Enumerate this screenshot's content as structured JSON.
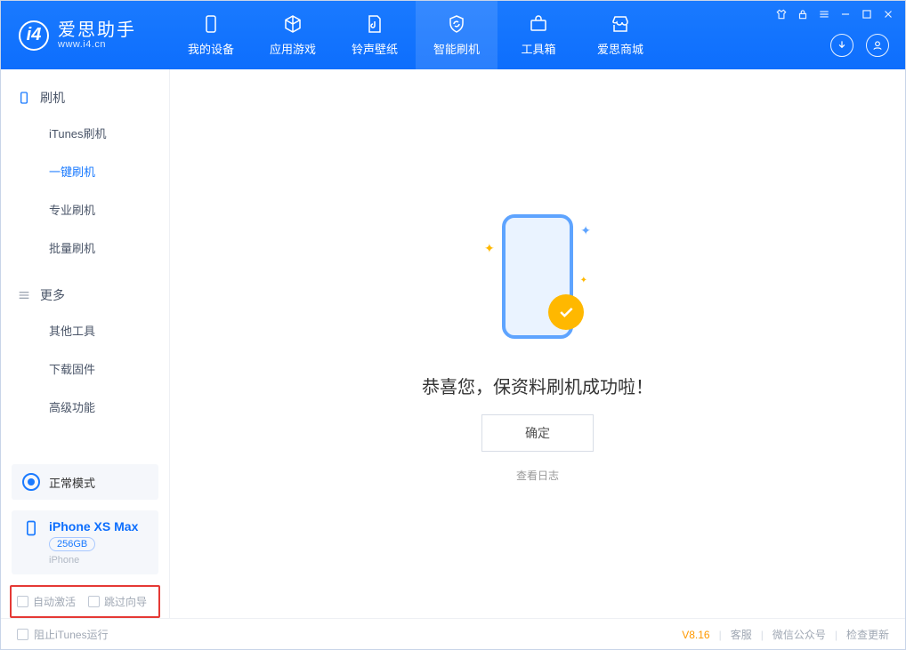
{
  "app": {
    "title": "爱思助手",
    "subtitle": "www.i4.cn"
  },
  "nav": [
    {
      "label": "我的设备"
    },
    {
      "label": "应用游戏"
    },
    {
      "label": "铃声壁纸"
    },
    {
      "label": "智能刷机"
    },
    {
      "label": "工具箱"
    },
    {
      "label": "爱思商城"
    }
  ],
  "sidebar": {
    "section1": {
      "title": "刷机",
      "items": [
        "iTunes刷机",
        "一键刷机",
        "专业刷机",
        "批量刷机"
      ]
    },
    "section2": {
      "title": "更多",
      "items": [
        "其他工具",
        "下载固件",
        "高级功能"
      ]
    }
  },
  "mode": {
    "label": "正常模式"
  },
  "device": {
    "name": "iPhone XS Max",
    "storage": "256GB",
    "type": "iPhone"
  },
  "options": {
    "auto_activate": "自动激活",
    "skip_guide": "跳过向导"
  },
  "main": {
    "success_text": "恭喜您，保资料刷机成功啦！",
    "ok": "确定",
    "view_log": "查看日志"
  },
  "footer": {
    "block_itunes": "阻止iTunes运行",
    "version": "V8.16",
    "support": "客服",
    "wechat": "微信公众号",
    "update": "检查更新"
  }
}
